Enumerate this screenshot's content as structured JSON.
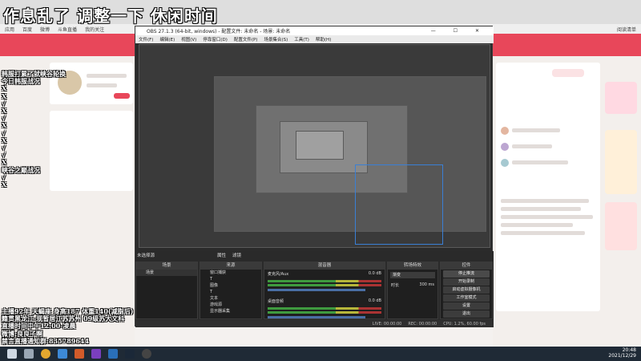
{
  "overlay": {
    "title": "作息乱了 调整一下 休闲时间",
    "left_lines": [
      "韩服打累了就峡谷轮换",
      "今日韩服战况",
      "X",
      "X",
      "√",
      "X",
      "√",
      "X",
      "√",
      "X",
      "√",
      "√",
      "X"
    ],
    "canyon_title": "峡谷之巅战况",
    "canyon_lines": [
      "√",
      "X"
    ],
    "bottom_lines": [
      "主播92年 天蝎座 身高187 体重140(减脂后)",
      "籍贯黑龙江-现暂居江苏苏州 09级苏大文科",
      "直播时间中午12:00-凌晨",
      "微博:良良子啊",
      "禁言直播通知群:835789644"
    ]
  },
  "browser": {
    "bookmarks": [
      "应用",
      "百度",
      "微博",
      "斗鱼直播",
      "我的关注"
    ],
    "right_button": "阅读清单"
  },
  "obs": {
    "title": "OBS 27.1.3 (64-bit, windows) - 配置文件: 未命名 - 场景: 未命名",
    "menu": [
      "文件(F)",
      "编辑(E)",
      "视图(V)",
      "停靠窗口(D)",
      "配置文件(P)",
      "场景集合(S)",
      "工具(T)",
      "帮助(H)"
    ],
    "no_source_selected": "未选择源",
    "properties_btn": "属性",
    "filters_btn": "滤镜",
    "docks": {
      "scenes": {
        "header": "场景",
        "items": [
          "场景"
        ]
      },
      "sources": {
        "header": "来源",
        "items": [
          "窗口捕获",
          "T",
          "图像",
          "T",
          "文本",
          "游戏源",
          "显示器采集"
        ]
      },
      "mixer": {
        "header": "混音器",
        "channels": [
          {
            "name": "麦克风/Aux",
            "db": "0.0 dB"
          },
          {
            "name": "桌面音频",
            "db": "0.0 dB"
          }
        ]
      },
      "transitions": {
        "header": "转场特效",
        "selected": "渐变",
        "duration_label": "时长",
        "duration": "300 ms"
      },
      "controls": {
        "header": "控件",
        "buttons": [
          "停止推流",
          "开始录制",
          "启动虚拟摄像机",
          "工作室模式",
          "设置",
          "退出"
        ]
      }
    },
    "status": {
      "live": "LIVE: 00:00:00",
      "rec": "REC: 00:00:00",
      "cpu": "CPU: 1.2%, 60.00 fps"
    }
  },
  "taskbar": {
    "time": "20:48",
    "date": "2021/12/29"
  },
  "colors": {
    "overlay_text": "#ffffff",
    "obs_bg": "#2b2b2b",
    "taskbar": "#1f2a36",
    "site_accent": "#e8475a",
    "selection_blue": "#3a7fd5"
  }
}
